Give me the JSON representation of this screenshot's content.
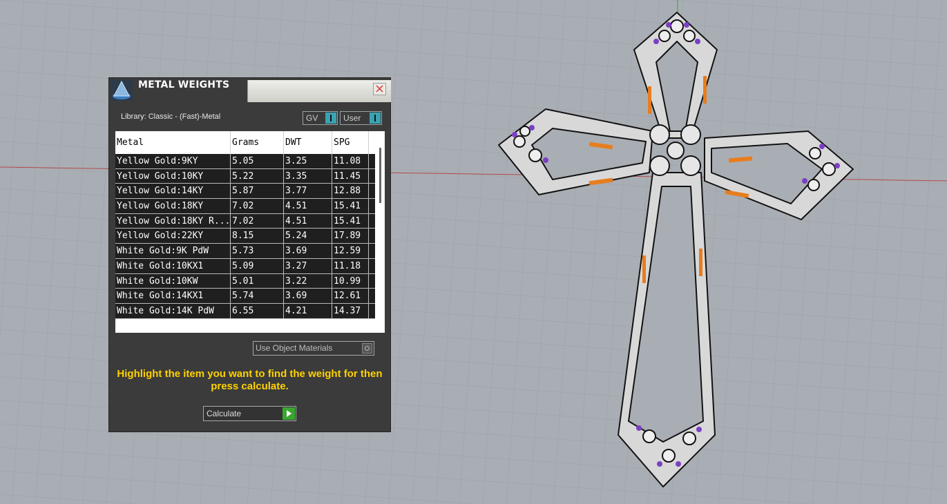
{
  "dialog": {
    "title": "METAL WEIGHTS",
    "library_label": "Library: Classic - (Fast)-Metal",
    "toggle_gv_label": "GV",
    "toggle_user_label": "User",
    "close_icon": "close-icon",
    "logo_icon": "app-logo-icon"
  },
  "table": {
    "headers": [
      "Metal",
      "Grams",
      "DWT",
      "SPG"
    ],
    "rows": [
      [
        "Yellow Gold:9KY",
        "5.05",
        "3.25",
        "11.08"
      ],
      [
        "Yellow Gold:10KY",
        "5.22",
        "3.35",
        "11.45"
      ],
      [
        "Yellow Gold:14KY",
        "5.87",
        "3.77",
        "12.88"
      ],
      [
        "Yellow Gold:18KY",
        "7.02",
        "4.51",
        "15.41"
      ],
      [
        "Yellow Gold:18KY R...",
        "7.02",
        "4.51",
        "15.41"
      ],
      [
        "Yellow Gold:22KY",
        "8.15",
        "5.24",
        "17.89"
      ],
      [
        "White Gold:9K PdW",
        "5.73",
        "3.69",
        "12.59"
      ],
      [
        "White Gold:10KX1",
        "5.09",
        "3.27",
        "11.18"
      ],
      [
        "White Gold:10KW",
        "5.01",
        "3.22",
        "10.99"
      ],
      [
        "White Gold:14KX1",
        "5.74",
        "3.69",
        "12.61"
      ],
      [
        "White Gold:14K PdW",
        "6.55",
        "4.21",
        "14.37"
      ]
    ]
  },
  "use_object_materials_label": "Use Object Materials",
  "instructions": "Highlight the item you want to find the weight for then press calculate.",
  "calculate_label": "Calculate",
  "colors": {
    "accent_teal": "#3aa3b2",
    "instruction_yellow": "#ffd200",
    "play_green": "#3aa630",
    "viewport_bg": "#a8adb3",
    "metal_orange": "#e87d1e",
    "gem_purple": "#7b3fc4"
  }
}
